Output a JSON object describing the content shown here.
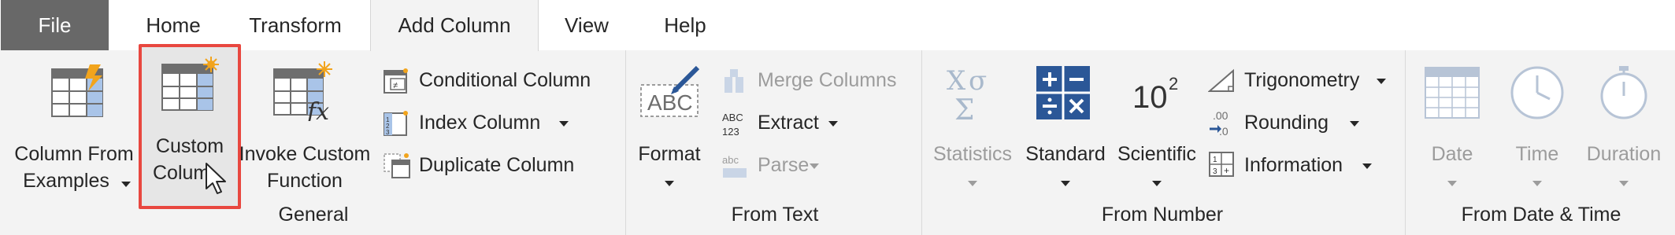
{
  "tabs": {
    "file": "File",
    "home": "Home",
    "transform": "Transform",
    "add_column": "Add Column",
    "view": "View",
    "help": "Help"
  },
  "general": {
    "column_from_examples": [
      "Column From",
      "Examples"
    ],
    "custom_column": [
      "Custom",
      "Colum"
    ],
    "invoke_custom_function": [
      "Invoke Custom",
      "Function"
    ],
    "conditional_column": "Conditional Column",
    "index_column": "Index Column",
    "duplicate_column": "Duplicate Column",
    "group_label": "General"
  },
  "from_text": {
    "format": "Format",
    "merge_columns": "Merge Columns",
    "extract": "Extract",
    "parse": "Parse",
    "group_label": "From Text"
  },
  "from_number": {
    "statistics": "Statistics",
    "standard": "Standard",
    "scientific": "Scientific",
    "scientific_icon_text": "10",
    "scientific_icon_exp": "2",
    "trigonometry": "Trigonometry",
    "rounding": "Rounding",
    "information": "Information",
    "group_label": "From Number"
  },
  "from_datetime": {
    "date": "Date",
    "time": "Time",
    "duration": "Duration",
    "group_label": "From Date & Time"
  },
  "colors": {
    "highlight": "#e8473f",
    "file_tab": "#686868",
    "ribbon_bg": "#f3f3f3",
    "icon_blue": "#2b5797",
    "disabled": "#9c9c9c"
  }
}
